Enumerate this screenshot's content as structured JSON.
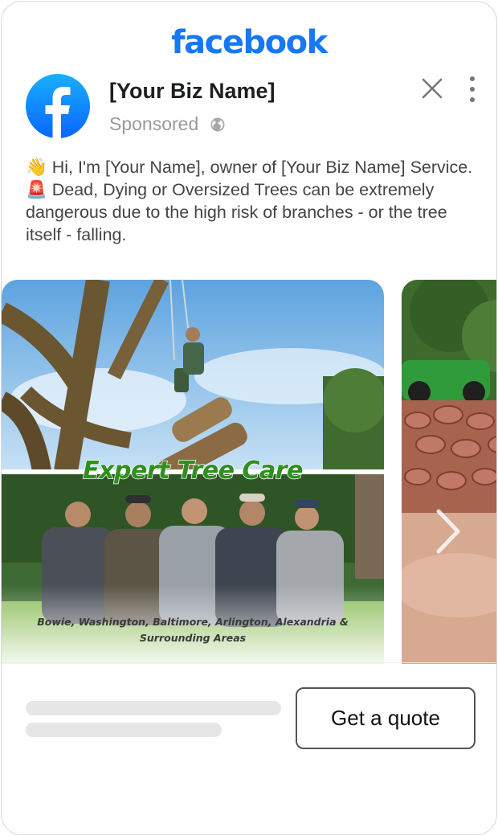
{
  "app": {
    "brand": "facebook"
  },
  "post": {
    "business_name": "[Your Biz Name]",
    "sponsored_label": "Sponsored",
    "body_line1": "👋 Hi, I'm [Your Name], owner of [Your Biz Name] Service.",
    "body_line2": "🚨 Dead, Dying or Oversized Trees can be extremely dangerous due to the high risk of branches - or the tree itself - falling."
  },
  "carousel": {
    "slides": [
      {
        "headline": "Expert Tree Care",
        "caption_line1": "Bowie, Washington, Baltimore, Arlington, Alexandria &",
        "caption_line2": "Surrounding Areas"
      },
      {}
    ]
  },
  "cta": {
    "label": "Get a quote"
  },
  "icons": {
    "logo": "facebook-f-logo",
    "audience": "globe-icon",
    "close": "close-icon",
    "more": "more-vertical-icon",
    "next": "chevron-right-icon"
  },
  "colors": {
    "brand": "#1877f2",
    "headline_green": "#2f8f1f"
  }
}
